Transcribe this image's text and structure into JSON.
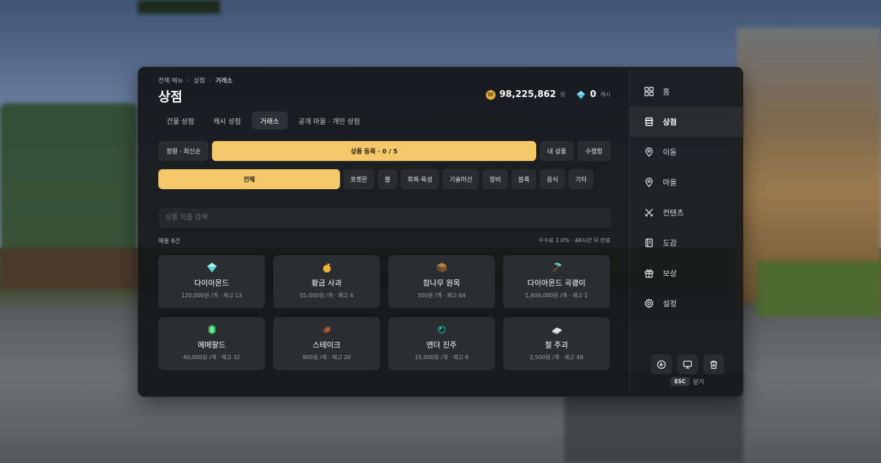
{
  "breadcrumb": [
    "전체 메뉴",
    "상점",
    "거래소"
  ],
  "page_title": "상점",
  "currency": {
    "coin_symbol": "W",
    "gold_amount": "98,225,862",
    "gold_unit": "원",
    "gem_amount": "0",
    "gem_unit": "캐시"
  },
  "tabs": [
    "건물 상점",
    "캐시 상점",
    "거래소",
    "공개 마을 · 개인 상점"
  ],
  "active_tab": "거래소",
  "actions": {
    "sort_label": "정렬 · 최신순",
    "register_label": "상품 등록 · 0 / 5",
    "my_items_label": "내 상품",
    "receive_label": "수령함"
  },
  "categories": [
    "전체",
    "포켓몬",
    "볼",
    "회복·육성",
    "기술머신",
    "장비",
    "블록",
    "음식",
    "기타"
  ],
  "search": {
    "placeholder": "상품 이름 검색",
    "value": ""
  },
  "list": {
    "count_label": "매물 8건",
    "fee_note": "수수료 1.0% · 48시간 뒤 만료",
    "items": [
      {
        "name": "다이아몬드",
        "meta": "120,000원 /개 · 재고 13",
        "icon": "diamond-icon"
      },
      {
        "name": "황금 사과",
        "meta": "55,000원 /개 · 재고 4",
        "icon": "golden-apple-icon"
      },
      {
        "name": "참나무 원목",
        "meta": "300원 /개 · 재고 64",
        "icon": "oak-log-icon"
      },
      {
        "name": "다이아몬드 곡괭이",
        "meta": "1,800,000원 /개 · 재고 1",
        "icon": "diamond-pickaxe-icon"
      },
      {
        "name": "에메랄드",
        "meta": "40,000원 /개 · 재고 32",
        "icon": "emerald-icon"
      },
      {
        "name": "스테이크",
        "meta": "900원 /개 · 재고 20",
        "icon": "steak-icon"
      },
      {
        "name": "엔더 진주",
        "meta": "15,000원 /개 · 재고 8",
        "icon": "ender-pearl-icon"
      },
      {
        "name": "철 주괴",
        "meta": "2,500원 /개 · 재고 48",
        "icon": "iron-ingot-icon"
      }
    ]
  },
  "sidebar": {
    "items": [
      {
        "label": "홈",
        "icon": "home-grid-icon"
      },
      {
        "label": "상점",
        "icon": "store-icon"
      },
      {
        "label": "이동",
        "icon": "location-pin-icon"
      },
      {
        "label": "마을",
        "icon": "village-pin-icon"
      },
      {
        "label": "컨텐츠",
        "icon": "crossed-swords-icon"
      },
      {
        "label": "도감",
        "icon": "book-icon"
      },
      {
        "label": "보상",
        "icon": "gift-icon"
      },
      {
        "label": "설정",
        "icon": "gear-icon"
      }
    ],
    "active": "상점",
    "esc_key": "ESC",
    "close_label": "닫기"
  },
  "colors": {
    "accent": "#f3c868",
    "panel": "#141518",
    "card": "#2b2d31"
  }
}
